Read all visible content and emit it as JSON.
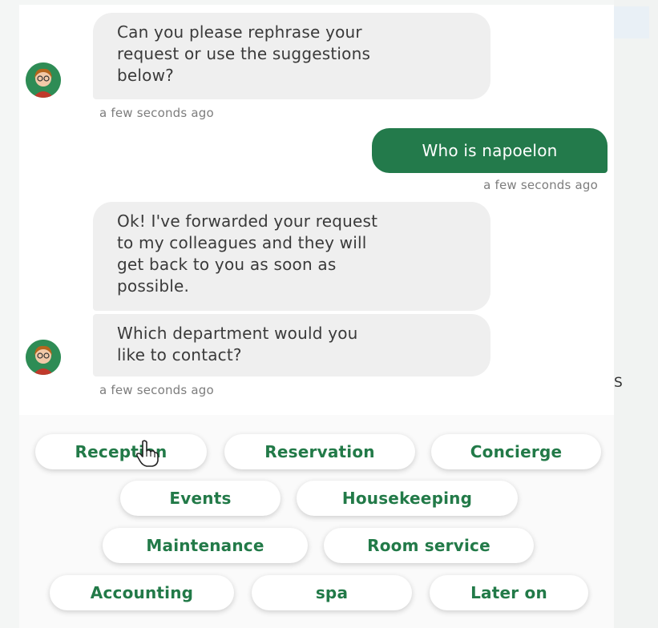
{
  "messages": [
    {
      "sender": "bot",
      "text_lines": [
        "Can you please rephrase your",
        "request or use the suggestions",
        "below?"
      ],
      "timestamp": "a few seconds ago"
    },
    {
      "sender": "user",
      "text": "Who is napoelon",
      "timestamp": "a few seconds ago"
    },
    {
      "sender": "bot",
      "text_lines": [
        "Ok! I've forwarded your request",
        "to my colleagues and they will",
        "get back to you as soon as",
        "possible."
      ]
    },
    {
      "sender": "bot",
      "text_lines": [
        "Which department would you",
        "like to contact?"
      ],
      "timestamp": "a few seconds ago"
    }
  ],
  "suggestions": [
    "Reception",
    "Reservation",
    "Concierge",
    "Events",
    "Housekeeping",
    "Maintenance",
    "Room service",
    "Accounting",
    "spa",
    "Later on"
  ],
  "background": {
    "edge_glyph": "S"
  },
  "colors": {
    "accent": "#237a4b",
    "chip_text": "#227a48",
    "bot_bubble": "#efefef",
    "timestamp": "#7d7d7d"
  },
  "icons": {
    "avatar": "bot-avatar-icon",
    "cursor": "hand-pointer-icon"
  }
}
